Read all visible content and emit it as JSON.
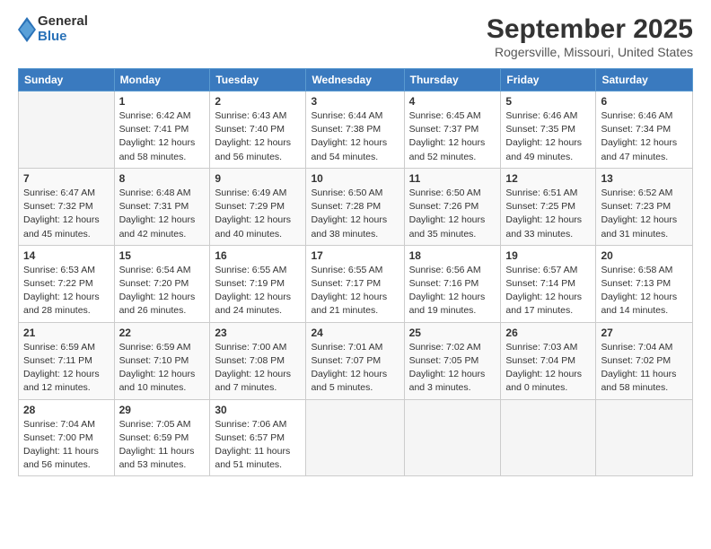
{
  "header": {
    "logo": {
      "line1": "General",
      "line2": "Blue"
    },
    "title": "September 2025",
    "location": "Rogersville, Missouri, United States"
  },
  "weekdays": [
    "Sunday",
    "Monday",
    "Tuesday",
    "Wednesday",
    "Thursday",
    "Friday",
    "Saturday"
  ],
  "weeks": [
    [
      {
        "day": null,
        "info": null
      },
      {
        "day": "1",
        "info": "Sunrise: 6:42 AM\nSunset: 7:41 PM\nDaylight: 12 hours\nand 58 minutes."
      },
      {
        "day": "2",
        "info": "Sunrise: 6:43 AM\nSunset: 7:40 PM\nDaylight: 12 hours\nand 56 minutes."
      },
      {
        "day": "3",
        "info": "Sunrise: 6:44 AM\nSunset: 7:38 PM\nDaylight: 12 hours\nand 54 minutes."
      },
      {
        "day": "4",
        "info": "Sunrise: 6:45 AM\nSunset: 7:37 PM\nDaylight: 12 hours\nand 52 minutes."
      },
      {
        "day": "5",
        "info": "Sunrise: 6:46 AM\nSunset: 7:35 PM\nDaylight: 12 hours\nand 49 minutes."
      },
      {
        "day": "6",
        "info": "Sunrise: 6:46 AM\nSunset: 7:34 PM\nDaylight: 12 hours\nand 47 minutes."
      }
    ],
    [
      {
        "day": "7",
        "info": "Sunrise: 6:47 AM\nSunset: 7:32 PM\nDaylight: 12 hours\nand 45 minutes."
      },
      {
        "day": "8",
        "info": "Sunrise: 6:48 AM\nSunset: 7:31 PM\nDaylight: 12 hours\nand 42 minutes."
      },
      {
        "day": "9",
        "info": "Sunrise: 6:49 AM\nSunset: 7:29 PM\nDaylight: 12 hours\nand 40 minutes."
      },
      {
        "day": "10",
        "info": "Sunrise: 6:50 AM\nSunset: 7:28 PM\nDaylight: 12 hours\nand 38 minutes."
      },
      {
        "day": "11",
        "info": "Sunrise: 6:50 AM\nSunset: 7:26 PM\nDaylight: 12 hours\nand 35 minutes."
      },
      {
        "day": "12",
        "info": "Sunrise: 6:51 AM\nSunset: 7:25 PM\nDaylight: 12 hours\nand 33 minutes."
      },
      {
        "day": "13",
        "info": "Sunrise: 6:52 AM\nSunset: 7:23 PM\nDaylight: 12 hours\nand 31 minutes."
      }
    ],
    [
      {
        "day": "14",
        "info": "Sunrise: 6:53 AM\nSunset: 7:22 PM\nDaylight: 12 hours\nand 28 minutes."
      },
      {
        "day": "15",
        "info": "Sunrise: 6:54 AM\nSunset: 7:20 PM\nDaylight: 12 hours\nand 26 minutes."
      },
      {
        "day": "16",
        "info": "Sunrise: 6:55 AM\nSunset: 7:19 PM\nDaylight: 12 hours\nand 24 minutes."
      },
      {
        "day": "17",
        "info": "Sunrise: 6:55 AM\nSunset: 7:17 PM\nDaylight: 12 hours\nand 21 minutes."
      },
      {
        "day": "18",
        "info": "Sunrise: 6:56 AM\nSunset: 7:16 PM\nDaylight: 12 hours\nand 19 minutes."
      },
      {
        "day": "19",
        "info": "Sunrise: 6:57 AM\nSunset: 7:14 PM\nDaylight: 12 hours\nand 17 minutes."
      },
      {
        "day": "20",
        "info": "Sunrise: 6:58 AM\nSunset: 7:13 PM\nDaylight: 12 hours\nand 14 minutes."
      }
    ],
    [
      {
        "day": "21",
        "info": "Sunrise: 6:59 AM\nSunset: 7:11 PM\nDaylight: 12 hours\nand 12 minutes."
      },
      {
        "day": "22",
        "info": "Sunrise: 6:59 AM\nSunset: 7:10 PM\nDaylight: 12 hours\nand 10 minutes."
      },
      {
        "day": "23",
        "info": "Sunrise: 7:00 AM\nSunset: 7:08 PM\nDaylight: 12 hours\nand 7 minutes."
      },
      {
        "day": "24",
        "info": "Sunrise: 7:01 AM\nSunset: 7:07 PM\nDaylight: 12 hours\nand 5 minutes."
      },
      {
        "day": "25",
        "info": "Sunrise: 7:02 AM\nSunset: 7:05 PM\nDaylight: 12 hours\nand 3 minutes."
      },
      {
        "day": "26",
        "info": "Sunrise: 7:03 AM\nSunset: 7:04 PM\nDaylight: 12 hours\nand 0 minutes."
      },
      {
        "day": "27",
        "info": "Sunrise: 7:04 AM\nSunset: 7:02 PM\nDaylight: 11 hours\nand 58 minutes."
      }
    ],
    [
      {
        "day": "28",
        "info": "Sunrise: 7:04 AM\nSunset: 7:00 PM\nDaylight: 11 hours\nand 56 minutes."
      },
      {
        "day": "29",
        "info": "Sunrise: 7:05 AM\nSunset: 6:59 PM\nDaylight: 11 hours\nand 53 minutes."
      },
      {
        "day": "30",
        "info": "Sunrise: 7:06 AM\nSunset: 6:57 PM\nDaylight: 11 hours\nand 51 minutes."
      },
      {
        "day": null,
        "info": null
      },
      {
        "day": null,
        "info": null
      },
      {
        "day": null,
        "info": null
      },
      {
        "day": null,
        "info": null
      }
    ]
  ]
}
